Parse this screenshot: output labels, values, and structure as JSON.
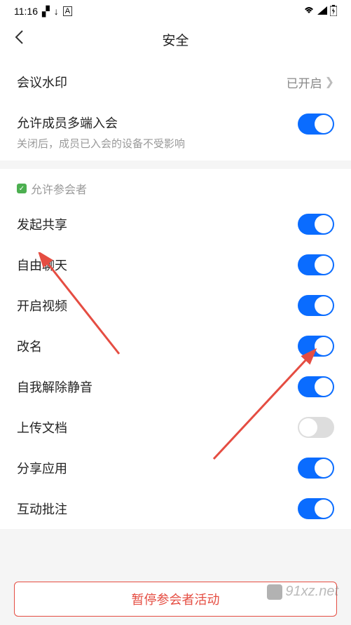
{
  "status": {
    "time": "11:16",
    "icons": [
      "chart-icon",
      "download-icon",
      "ad-icon"
    ],
    "right_icons": [
      "wifi-icon",
      "signal-icon",
      "battery-icon"
    ]
  },
  "header": {
    "title": "安全"
  },
  "top_section": {
    "watermark_label": "会议水印",
    "watermark_value": "已开启",
    "multi_login_label": "允许成员多端入会",
    "multi_login_sub": "关闭后，成员已入会的设备不受影响",
    "multi_login_on": true
  },
  "attendee_section": {
    "header_label": "允许参会者",
    "items": [
      {
        "label": "发起共享",
        "on": true
      },
      {
        "label": "自由聊天",
        "on": true
      },
      {
        "label": "开启视频",
        "on": true
      },
      {
        "label": "改名",
        "on": true
      },
      {
        "label": "自我解除静音",
        "on": true
      },
      {
        "label": "上传文档",
        "on": false
      },
      {
        "label": "分享应用",
        "on": true
      },
      {
        "label": "互动批注",
        "on": true
      }
    ]
  },
  "bottom_button": "暂停参会者活动",
  "watermark_text": "91xz.net",
  "accent_color": "#0A6CFF",
  "danger_color": "#E54D42"
}
